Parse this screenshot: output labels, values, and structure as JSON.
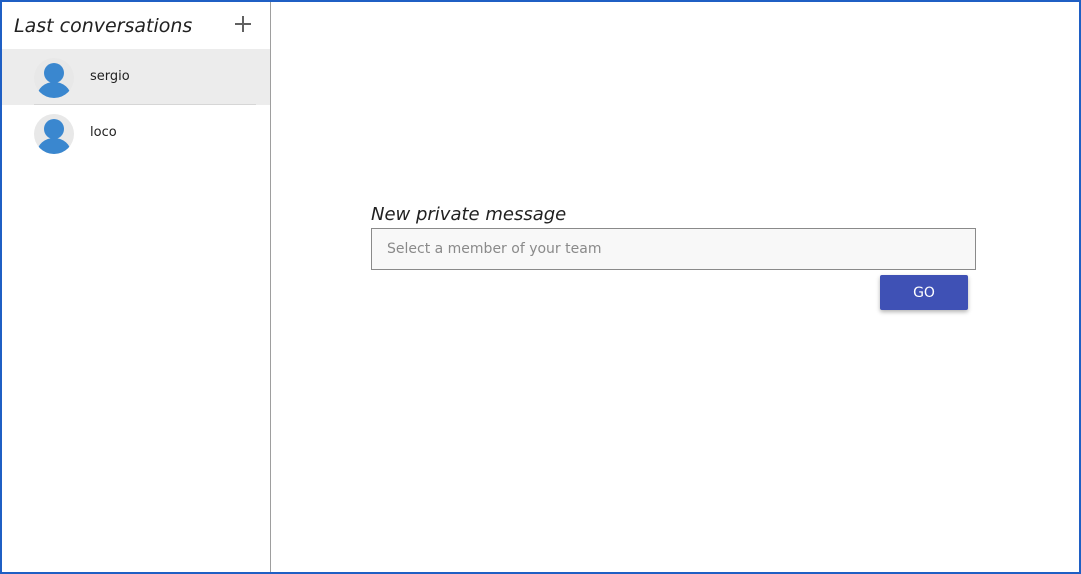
{
  "sidebar": {
    "title": "Last conversations",
    "add_icon": "plus-icon",
    "conversations": [
      {
        "name": "sergio",
        "avatar_icon": "user-avatar-icon",
        "selected": true
      },
      {
        "name": "loco",
        "avatar_icon": "user-avatar-icon",
        "selected": false
      }
    ]
  },
  "main": {
    "new_message_title": "New private message",
    "member_input": {
      "value": "",
      "placeholder": "Select a member of your team"
    },
    "go_label": "GO"
  },
  "colors": {
    "frame_border": "#1f5fc4",
    "avatar_blue": "#3a87cf",
    "button_primary": "#3f51b5",
    "selected_row": "#ececec"
  }
}
